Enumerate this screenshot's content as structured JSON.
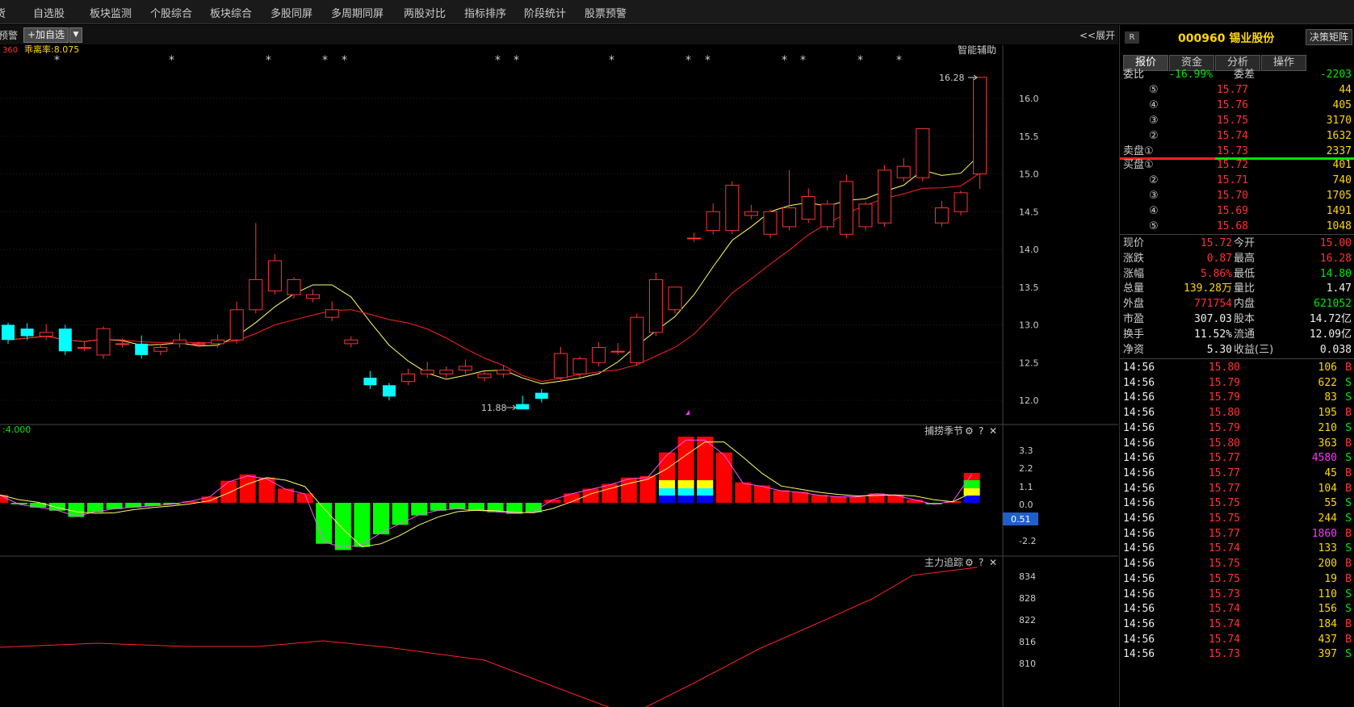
{
  "topnav": {
    "items": [
      "货",
      "自选股",
      "板块监测",
      "个股综合",
      "板块综合",
      "多股同屏",
      "多周期同屏",
      "两股对比",
      "指标排序",
      "阶段统计",
      "股票预警"
    ]
  },
  "toolbar": {
    "left_text": "预警",
    "add_label": "+加自选",
    "drop_label": "▼",
    "expand_label": "<<展开",
    "indicator_left": "360",
    "indicator_label": "乖离率:8.075",
    "assist_label": "智能辅助"
  },
  "price_axis": {
    "labels": [
      "16.0",
      "15.5",
      "15.0",
      "14.5",
      "14.0",
      "13.5",
      "13.0",
      "12.5",
      "12.0"
    ]
  },
  "annotations": {
    "high": "16.28",
    "low": "11.88"
  },
  "subchart1": {
    "title": "捕捞季节",
    "left_value": ":4.000",
    "axis": [
      "3.3",
      "2.2",
      "1.1",
      "0.0",
      "-1.1",
      "-2.2"
    ],
    "current": "0.51"
  },
  "subchart2": {
    "title": "主力追踪",
    "axis": [
      "834",
      "828",
      "822",
      "816",
      "810"
    ]
  },
  "colors": {
    "up": "#ff3333",
    "down": "#00ffff",
    "ma5": "#ffff66",
    "ma10": "#ff2222",
    "green_bar": "#00ff00",
    "red_bar": "#ff0000"
  },
  "stock": {
    "code": "000960",
    "name": "锡业股份",
    "badge": "R",
    "decision_label": "决策矩阵"
  },
  "tabs": [
    "报价",
    "资金",
    "分析",
    "操作"
  ],
  "weibi": {
    "label1": "委比",
    "v1": "-16.99%",
    "label2": "委差",
    "v2": "-2203"
  },
  "asks": [
    {
      "lvl": "⑤",
      "price": "15.77",
      "vol": "44"
    },
    {
      "lvl": "④",
      "price": "15.76",
      "vol": "405"
    },
    {
      "lvl": "③",
      "price": "15.75",
      "vol": "3170"
    },
    {
      "lvl": "②",
      "price": "15.74",
      "vol": "1632"
    },
    {
      "lvl": "卖盘①",
      "price": "15.73",
      "vol": "2337"
    }
  ],
  "bids": [
    {
      "lvl": "买盘①",
      "price": "15.72",
      "vol": "401"
    },
    {
      "lvl": "②",
      "price": "15.71",
      "vol": "740"
    },
    {
      "lvl": "③",
      "price": "15.70",
      "vol": "1705"
    },
    {
      "lvl": "④",
      "price": "15.69",
      "vol": "1491"
    },
    {
      "lvl": "⑤",
      "price": "15.68",
      "vol": "1048"
    }
  ],
  "quote": [
    {
      "l1": "现价",
      "v1": "15.72",
      "c1": "red",
      "l2": "今开",
      "v2": "15.00",
      "c2": "red"
    },
    {
      "l1": "涨跌",
      "v1": "0.87",
      "c1": "red",
      "l2": "最高",
      "v2": "16.28",
      "c2": "red"
    },
    {
      "l1": "涨幅",
      "v1": "5.86%",
      "c1": "red",
      "l2": "最低",
      "v2": "14.80",
      "c2": "grn"
    },
    {
      "l1": "总量",
      "v1": "139.28万",
      "c1": "yel",
      "l2": "量比",
      "v2": "1.47",
      "c2": "wht"
    },
    {
      "l1": "外盘",
      "v1": "771754",
      "c1": "red",
      "l2": "内盘",
      "v2": "621052",
      "c2": "grn"
    },
    {
      "l1": "市盈",
      "v1": "307.03",
      "c1": "wht",
      "l2": "股本",
      "v2": "14.72亿",
      "c2": "wht"
    },
    {
      "l1": "换手",
      "v1": "11.52%",
      "c1": "wht",
      "l2": "流通",
      "v2": "12.09亿",
      "c2": "wht"
    },
    {
      "l1": "净资",
      "v1": "5.30",
      "c1": "wht",
      "l2": "收益(三)",
      "v2": "0.038",
      "c2": "wht"
    }
  ],
  "ticks": [
    {
      "t": "14:56",
      "p": "15.80",
      "v": "106",
      "s": "B"
    },
    {
      "t": "14:56",
      "p": "15.79",
      "v": "622",
      "s": "S"
    },
    {
      "t": "14:56",
      "p": "15.79",
      "v": "83",
      "s": "S"
    },
    {
      "t": "14:56",
      "p": "15.80",
      "v": "195",
      "s": "B"
    },
    {
      "t": "14:56",
      "p": "15.79",
      "v": "210",
      "s": "S"
    },
    {
      "t": "14:56",
      "p": "15.80",
      "v": "363",
      "s": "B"
    },
    {
      "t": "14:56",
      "p": "15.77",
      "v": "4580",
      "s": "S"
    },
    {
      "t": "14:56",
      "p": "15.77",
      "v": "45",
      "s": "B"
    },
    {
      "t": "14:56",
      "p": "15.77",
      "v": "104",
      "s": "B"
    },
    {
      "t": "14:56",
      "p": "15.75",
      "v": "55",
      "s": "S"
    },
    {
      "t": "14:56",
      "p": "15.75",
      "v": "244",
      "s": "S"
    },
    {
      "t": "14:56",
      "p": "15.77",
      "v": "1860",
      "s": "B"
    },
    {
      "t": "14:56",
      "p": "15.74",
      "v": "133",
      "s": "S"
    },
    {
      "t": "14:56",
      "p": "15.75",
      "v": "200",
      "s": "B"
    },
    {
      "t": "14:56",
      "p": "15.75",
      "v": "19",
      "s": "B"
    },
    {
      "t": "14:56",
      "p": "15.73",
      "v": "110",
      "s": "S"
    },
    {
      "t": "14:56",
      "p": "15.74",
      "v": "156",
      "s": "S"
    },
    {
      "t": "14:56",
      "p": "15.74",
      "v": "184",
      "s": "B"
    },
    {
      "t": "14:56",
      "p": "15.74",
      "v": "437",
      "s": "B"
    },
    {
      "t": "14:56",
      "p": "15.73",
      "v": "397",
      "s": "S"
    }
  ],
  "chart_data": {
    "type": "candlestick",
    "ohlc": [
      [
        13.0,
        13.0,
        12.75,
        12.8
      ],
      [
        12.95,
        13.1,
        12.8,
        12.85
      ],
      [
        12.85,
        12.9,
        12.8,
        12.9
      ],
      [
        12.95,
        13.0,
        12.7,
        12.65
      ],
      [
        12.7,
        12.75,
        12.7,
        12.7
      ],
      [
        12.6,
        12.9,
        12.6,
        12.95
      ],
      [
        12.75,
        12.8,
        12.65,
        12.75
      ],
      [
        12.75,
        12.8,
        12.6,
        12.6
      ],
      [
        12.65,
        12.75,
        12.6,
        12.7
      ],
      [
        12.75,
        12.8,
        12.7,
        12.8
      ],
      [
        12.75,
        12.8,
        12.75,
        12.75
      ],
      [
        12.75,
        12.85,
        12.7,
        12.8
      ],
      [
        12.8,
        13.1,
        12.8,
        13.2
      ],
      [
        13.2,
        13.35,
        13.05,
        13.6
      ],
      [
        13.45,
        13.5,
        13.4,
        13.85
      ],
      [
        13.4,
        13.4,
        13.35,
        13.6
      ],
      [
        13.35,
        13.35,
        13.2,
        13.4
      ],
      [
        13.1,
        13.1,
        12.95,
        13.2
      ],
      [
        12.75,
        12.75,
        12.3,
        12.8
      ],
      [
        12.3,
        12.3,
        12.2,
        12.2
      ],
      [
        12.2,
        12.2,
        12.15,
        12.05
      ],
      [
        12.25,
        12.25,
        12.15,
        12.35
      ],
      [
        12.35,
        12.35,
        12.3,
        12.4
      ],
      [
        12.35,
        12.35,
        12.35,
        12.4
      ],
      [
        12.4,
        12.4,
        12.25,
        12.45
      ],
      [
        12.3,
        12.3,
        12.15,
        12.35
      ],
      [
        12.35,
        12.35,
        11.95,
        12.4
      ],
      [
        11.95,
        12.05,
        11.95,
        11.88
      ],
      [
        12.1,
        12.1,
        12.05,
        12.02
      ],
      [
        12.3,
        12.35,
        12.3,
        12.62
      ],
      [
        12.35,
        12.5,
        12.35,
        12.55
      ],
      [
        12.5,
        12.65,
        12.5,
        12.7
      ],
      [
        12.65,
        12.65,
        12.64,
        12.65
      ],
      [
        12.5,
        12.9,
        12.5,
        13.1
      ],
      [
        12.9,
        13.5,
        12.9,
        13.6
      ],
      [
        13.2,
        13.5,
        13.0,
        13.5
      ],
      [
        14.15,
        14.15,
        14.15,
        14.15
      ],
      [
        14.25,
        14.25,
        14.15,
        14.5
      ],
      [
        14.25,
        14.6,
        14.25,
        14.85
      ],
      [
        14.45,
        14.5,
        14.4,
        14.5
      ],
      [
        14.2,
        14.25,
        14.0,
        14.5
      ],
      [
        14.3,
        14.45,
        14.2,
        14.55
      ],
      [
        14.4,
        14.65,
        14.4,
        14.7
      ],
      [
        14.3,
        14.6,
        14.3,
        14.6
      ],
      [
        14.2,
        14.35,
        14.2,
        14.9
      ],
      [
        14.3,
        14.3,
        14.2,
        14.6
      ],
      [
        14.35,
        14.35,
        14.25,
        15.05
      ],
      [
        14.95,
        15.0,
        14.9,
        15.1
      ],
      [
        14.95,
        14.95,
        14.9,
        15.6
      ],
      [
        14.35,
        14.5,
        14.1,
        14.55
      ],
      [
        14.5,
        14.5,
        14.45,
        14.75
      ],
      [
        15.0,
        15.72,
        14.8,
        16.28
      ]
    ],
    "ylim": [
      11.7,
      16.5
    ]
  }
}
